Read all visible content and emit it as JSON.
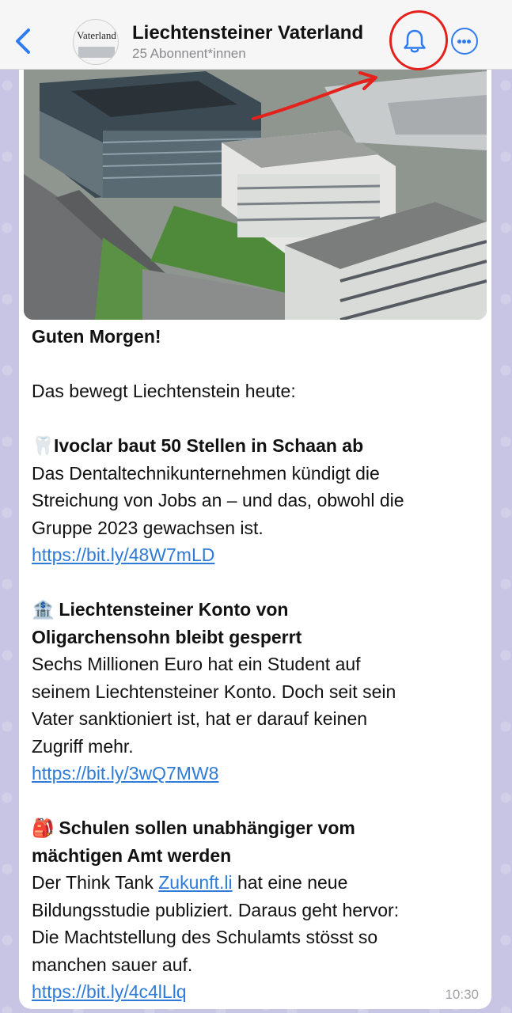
{
  "header": {
    "back_icon": "chevron-left-icon",
    "avatar_logo": "Vaterland",
    "title": "Liechtensteiner Vaterland",
    "subscribers": "25 Abonnent*innen",
    "bell_icon": "bell-icon",
    "more_icon": "ellipsis-circle-icon",
    "annotation_color": "#e4211b",
    "accent_color": "#2f7bf0"
  },
  "message": {
    "image": "aerial-photo-ivoclar-campus",
    "greeting": "Guten Morgen!",
    "intro": "Das bewegt Liechtenstein heute:",
    "items": [
      {
        "emoji": "🦷",
        "headline_1": "Ivoclar baut 50 Stellen in Schaan ab",
        "body": [
          "Das Dentaltechnikunternehmen kündigt die",
          "Streichung von Jobs an – und das, obwohl die",
          "Gruppe 2023 gewachsen ist."
        ],
        "link": "https://bit.ly/48W7mLD"
      },
      {
        "emoji": "🏦",
        "headline_1": "Liechtensteiner Konto von",
        "headline_2": "Oligarchensohn bleibt gesperrt",
        "body": [
          "Sechs Millionen Euro hat ein Student auf",
          "seinem Liechtensteiner Konto. Doch seit sein",
          "Vater sanktioniert ist, hat er darauf keinen",
          "Zugriff mehr."
        ],
        "link": "https://bit.ly/3wQ7MW8"
      },
      {
        "emoji": "🎒",
        "headline_1": "Schulen sollen unabhängiger vom",
        "headline_2": "mächtigen Amt werden",
        "body_pre": "Der Think Tank ",
        "body_link": "Zukunft.li",
        "body_post": " hat eine neue",
        "body": [
          "Bildungsstudie publiziert. Daraus geht hervor:",
          "Die Machtstellung des Schulamts stösst so",
          "manchen sauer auf."
        ],
        "link": "https://bit.ly/4c4lLlq"
      }
    ],
    "time": "10:30"
  }
}
